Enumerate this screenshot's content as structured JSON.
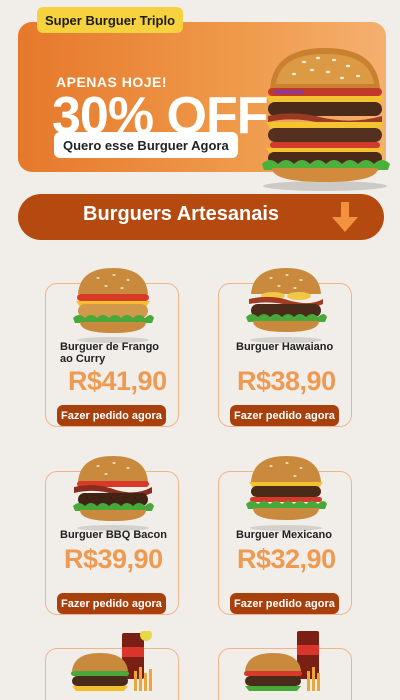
{
  "hero": {
    "tag": "Super Burguer Triplo",
    "subtitle": "APENAS HOJE!",
    "discount": "30% OFF",
    "cta_label": "Quero esse Burguer Agora"
  },
  "section": {
    "title": "Burguers Artesanais"
  },
  "products": [
    {
      "name": "Burguer de Frango ao Curry",
      "price": "R$41,90",
      "button": "Fazer pedido agora"
    },
    {
      "name": "Burguer Hawaiano",
      "price": "R$38,90",
      "button": "Fazer pedido agora"
    },
    {
      "name": "Burguer BBQ Bacon",
      "price": "R$39,90",
      "button": "Fazer pedido agora"
    },
    {
      "name": "Burguer Mexicano",
      "price": "R$32,90",
      "button": "Fazer pedido agora"
    }
  ],
  "colors": {
    "hero_gradient_start": "#e6782b",
    "hero_gradient_end": "#f4b070",
    "tag_yellow": "#f7d23f",
    "section_bar": "#b54a10",
    "price_orange": "#ef9a52",
    "button_brown": "#a8400d"
  }
}
